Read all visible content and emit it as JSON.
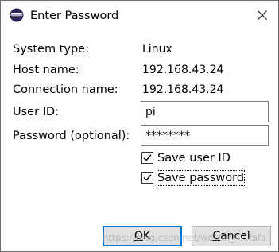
{
  "window": {
    "title": "Enter Password",
    "icon": "eclipse-icon",
    "close_icon": "close-icon"
  },
  "fields": {
    "system_type_label": "System type:",
    "system_type_value": "Linux",
    "host_name_label": "Host name:",
    "host_name_value": "192.168.43.24",
    "connection_name_label": "Connection name:",
    "connection_name_value": "192.168.43.24",
    "user_id_label": "User ID:",
    "user_id_value": "pi",
    "password_label": "Password (optional):",
    "password_value": "********"
  },
  "options": {
    "save_user_id": {
      "label": "Save user ID",
      "checked": true
    },
    "save_password": {
      "label": "Save password",
      "checked": true
    }
  },
  "buttons": {
    "ok_label_pre": "",
    "ok_mnemonic": "O",
    "ok_label_post": "K",
    "cancel_label_pre": "",
    "cancel_mnemonic": "C",
    "cancel_label_post": "ancel"
  },
  "watermark": "https://blog.csdn.net/weixin_4...fafa",
  "colors": {
    "accent": "#0078d7",
    "eclipse_purple": "#2c2255",
    "eclipse_orange": "#f7941e"
  }
}
